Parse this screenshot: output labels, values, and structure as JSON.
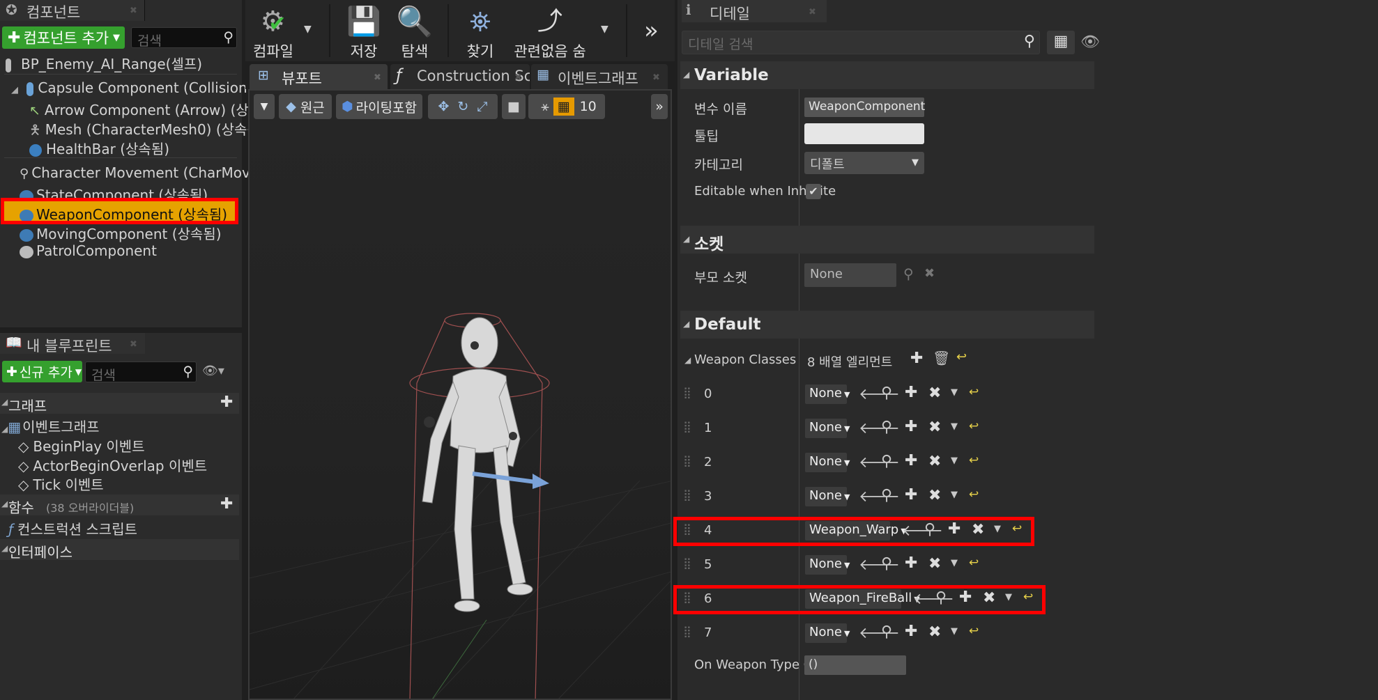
{
  "components_panel": {
    "tab_label": "컴포넌트",
    "add_button": "컴포넌트 추가",
    "search_placeholder": "검색",
    "root_item": "BP_Enemy_AI_Range(셀프)",
    "items": [
      "Capsule Component (CollisionCylinder)",
      "Arrow Component (Arrow) (상속됨)",
      "Mesh (CharacterMesh0) (상속됨)",
      "HealthBar (상속됨)",
      "Character Movement (CharMoveComp)",
      "StateComponent (상속됨)",
      "WeaponComponent (상속됨)",
      "MovingComponent (상속됨)",
      "PatrolComponent"
    ]
  },
  "blueprint_panel": {
    "tab_label": "내 블루프린트",
    "add_button": "신규 추가",
    "search_placeholder": "검색",
    "graph_header": "그래프",
    "event_graph": "이벤트그래프",
    "events": [
      "BeginPlay 이벤트",
      "ActorBeginOverlap 이벤트",
      "Tick 이벤트"
    ],
    "functions_header": "함수",
    "functions_note": "(38 오버라이더블)",
    "construction_script": "컨스트럭션 스크립트",
    "interface_header": "인터페이스"
  },
  "toolbar": {
    "compile": "컴파일",
    "save": "저장",
    "browse": "탐색",
    "find": "찾기",
    "hide_unrelated": "관련없음 숨김"
  },
  "editor_tabs": [
    "뷰포트",
    "Construction Scri",
    "이벤트그래프"
  ],
  "viewport_toolbar": {
    "perspective": "원근",
    "lighting": "라이팅포함",
    "grid_size": "10"
  },
  "details_panel": {
    "tab_label": "디테일",
    "search_placeholder": "디테일 검색",
    "variable_section": "Variable",
    "var_name_label": "변수 이름",
    "var_name_value": "WeaponComponent",
    "tooltip_label": "툴팁",
    "category_label": "카테고리",
    "category_value": "디폴트",
    "editable_label": "Editable when Inherite",
    "socket_section": "소켓",
    "parent_socket_label": "부모 소켓",
    "parent_socket_value": "None",
    "default_section": "Default",
    "weapon_classes_label": "Weapon Classes",
    "weapon_classes_value": "8 배열 엘리먼트",
    "array": [
      {
        "index": "0",
        "value": "None"
      },
      {
        "index": "1",
        "value": "None"
      },
      {
        "index": "2",
        "value": "None"
      },
      {
        "index": "3",
        "value": "None"
      },
      {
        "index": "4",
        "value": "Weapon_Warp"
      },
      {
        "index": "5",
        "value": "None"
      },
      {
        "index": "6",
        "value": "Weapon_FireBall"
      },
      {
        "index": "7",
        "value": "None"
      }
    ],
    "event_label": "On Weapon Type Char",
    "event_value": "()"
  },
  "colors": {
    "selection": "#e6a200",
    "highlight_box": "#ff0000",
    "add_green": "#35a02e"
  }
}
